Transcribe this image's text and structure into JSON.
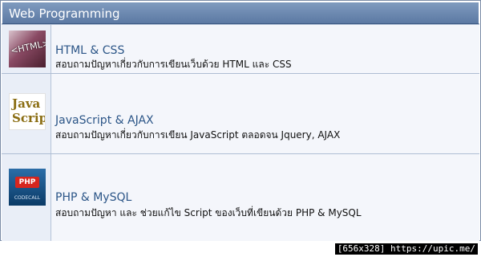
{
  "section": {
    "title": "Web Programming"
  },
  "forums": [
    {
      "title": "HTML & CSS",
      "description": "สอบถามปัญหาเกี่ยวกับการเขียนเว็บด้วย HTML และ CSS",
      "icon": {
        "name": "html-icon",
        "text": "<HTML>"
      }
    },
    {
      "title": "JavaScript & AJAX",
      "description": "สอบถามปัญหาเกี่ยวกับการเขียน JavaScript ตลอดจน Jquery, AJAX",
      "icon": {
        "name": "javascript-icon",
        "line1": "Java",
        "line2": "Script"
      }
    },
    {
      "title": "PHP & MySQL",
      "description": "สอบถามปัญหา และ ช่วยแก้ไข Script ของเว็บที่เขียนด้วย PHP & MySQL",
      "icon": {
        "name": "php-icon",
        "badge": "PHP",
        "caption": "CODECALL"
      }
    }
  ],
  "watermark": "[656x328] https://upic.me/"
}
